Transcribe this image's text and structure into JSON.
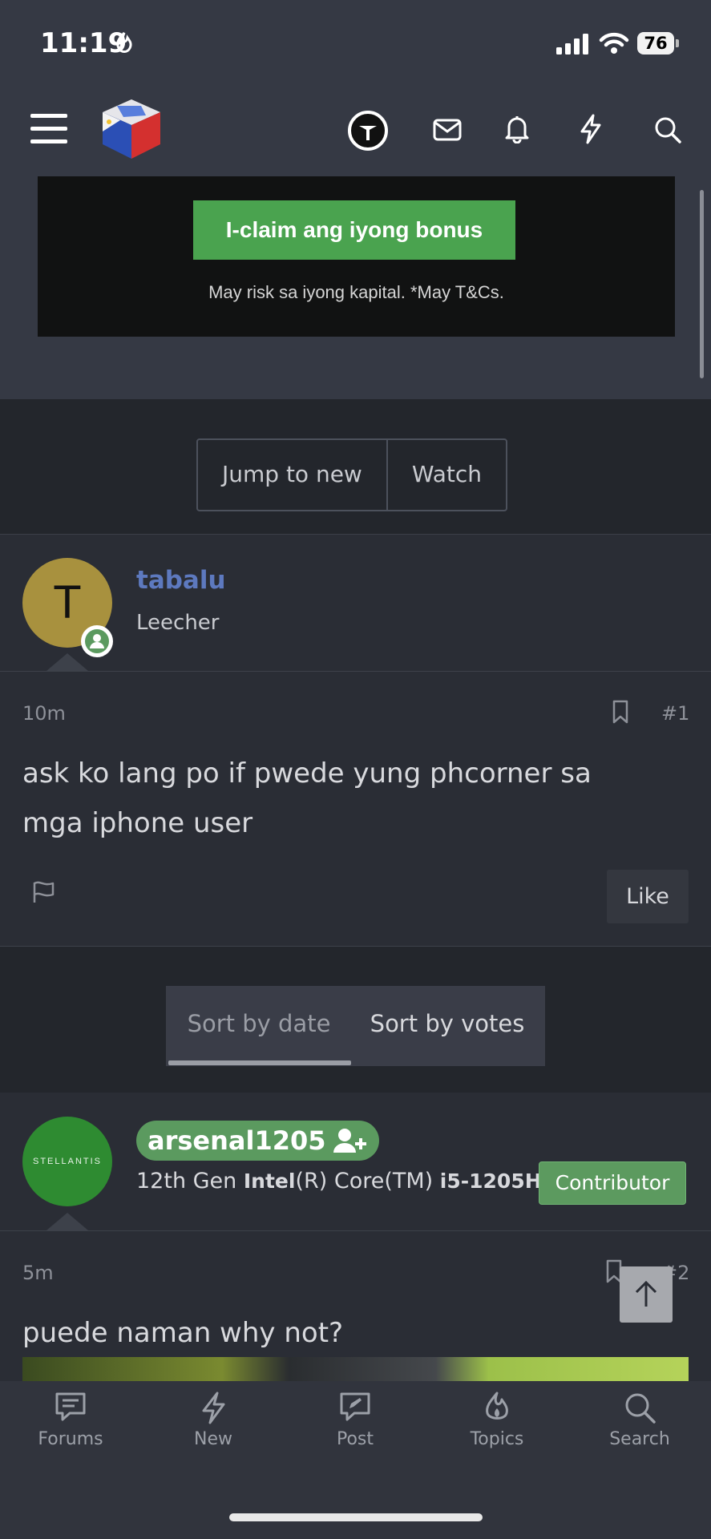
{
  "status_bar": {
    "time": "11:19",
    "battery": "76"
  },
  "ad": {
    "button_label": "I-claim ang iyong bonus",
    "disclaimer": "May risk sa iyong kapital. *May T&Cs."
  },
  "thread_actions": {
    "jump_label": "Jump to new",
    "watch_label": "Watch"
  },
  "post1": {
    "avatar_letter": "T",
    "username": "tabalu",
    "user_title": "Leecher",
    "time": "10m",
    "number": "#1",
    "body_line1": "ask ko lang po if pwede yung phcorner sa",
    "body_line2": "mga iphone user",
    "like_label": "Like"
  },
  "sort": {
    "by_date": "Sort by date",
    "by_votes": "Sort by votes"
  },
  "post2": {
    "avatar_text": "STELLANTIS",
    "username": "arsenal1205",
    "title_prefix": "12th Gen ",
    "title_brand": "Intel",
    "title_mid": "(R) Core(TM) ",
    "title_model": "i5-1205H",
    "badge": "Contributor",
    "time": "5m",
    "number": "#2",
    "body": "puede naman why not?"
  },
  "bottom_nav": [
    {
      "label": "Forums",
      "icon": "forums-icon"
    },
    {
      "label": "New",
      "icon": "lightning-icon"
    },
    {
      "label": "Post",
      "icon": "compose-icon"
    },
    {
      "label": "Topics",
      "icon": "fire-icon"
    },
    {
      "label": "Search",
      "icon": "search-icon"
    }
  ],
  "colors": {
    "accent_green": "#5b9a5f",
    "username_blue": "#5d79bf",
    "background": "#2a2d35"
  }
}
